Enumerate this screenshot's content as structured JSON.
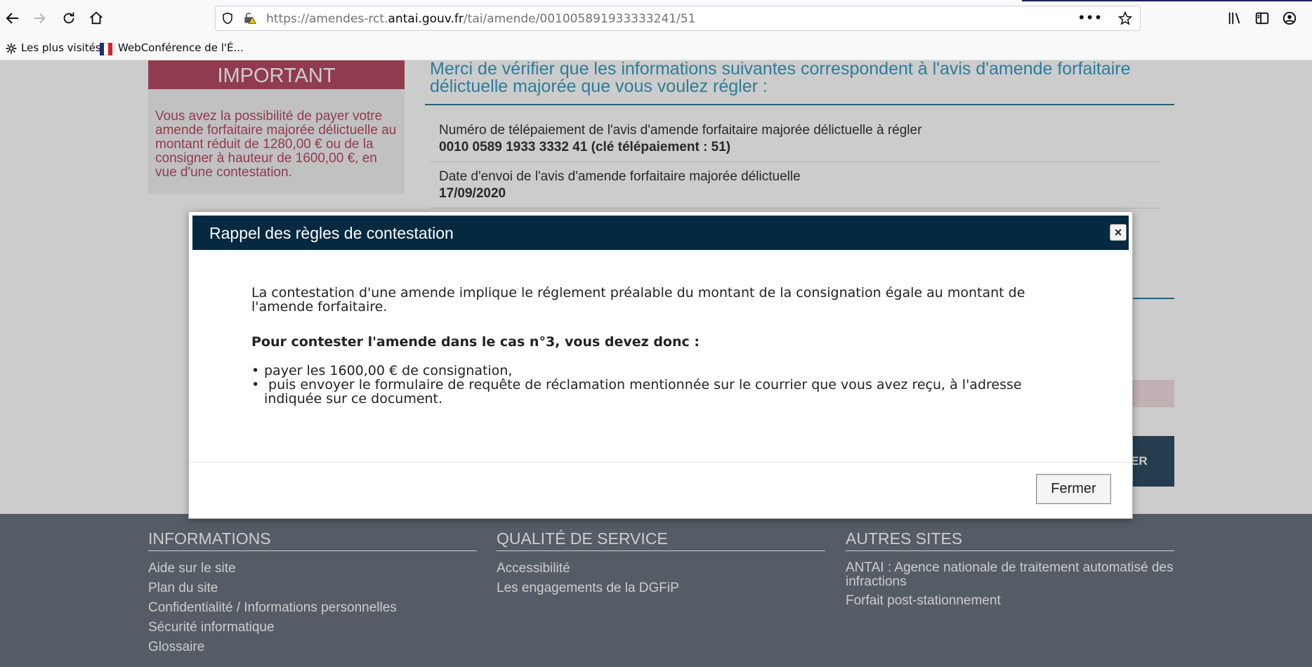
{
  "browser": {
    "url_prefix": "https://amendes-rct.",
    "url_domain": "antai.gouv.fr",
    "url_path": "/tai/amende/001005891933333241/51",
    "bookmarks": [
      "Les plus visités",
      "WebConférence de l'É..."
    ]
  },
  "important": {
    "title": "IMPORTANT",
    "text": "Vous avez la possibilité de payer votre amende forfaitaire majorée délictuelle au montant réduit de 1280,00 € ou de la consigner à hauteur de 1600,00 €, en vue d'une contestation."
  },
  "verify": {
    "title": "Merci de vérifier que les informations suivantes correspondent à l'avis d'amende forfaitaire délictuelle majorée que vous voulez régler :",
    "rows": [
      {
        "label": "Numéro de télépaiement de l'avis d'amende forfaitaire majorée délictuelle à régler",
        "value": "0010 0589 1933 3332 41 (clé télépaiement : 51)"
      },
      {
        "label": "Date d'envoi de l'avis d'amende forfaitaire majorée délictuelle",
        "value": "17/09/2020"
      }
    ],
    "button_fragment": "ER"
  },
  "modal": {
    "title": "Rappel des règles de contestation",
    "close": "×",
    "intro": "La contestation d'une amende implique le réglement préalable du montant de la consignation égale au montant de l'amende forfaitaire.",
    "heading": "Pour contester l'amende dans le cas n°3, vous devez donc :",
    "items": [
      "payer les 1600,00 € de consignation,",
      " puis envoyer le formulaire de requête de réclamation mentionnée sur le courrier que vous avez reçu, à l'adresse indiquée sur ce document."
    ],
    "button": "Fermer"
  },
  "footer": {
    "informations": {
      "title": "INFORMATIONS",
      "links": [
        "Aide sur le site",
        "Plan du site",
        "Confidentialité / Informations personnelles",
        "Sécurité informatique",
        "Glossaire"
      ]
    },
    "qualite": {
      "title": "QUALITÉ DE SERVICE",
      "links": [
        "Accessibilité",
        "Les engagements de la DGFiP"
      ]
    },
    "autres": {
      "title": "AUTRES SITES",
      "links": [
        "ANTAI : Agence nationale de traitement automatisé des infractions",
        "Forfait post-stationnement"
      ]
    }
  }
}
